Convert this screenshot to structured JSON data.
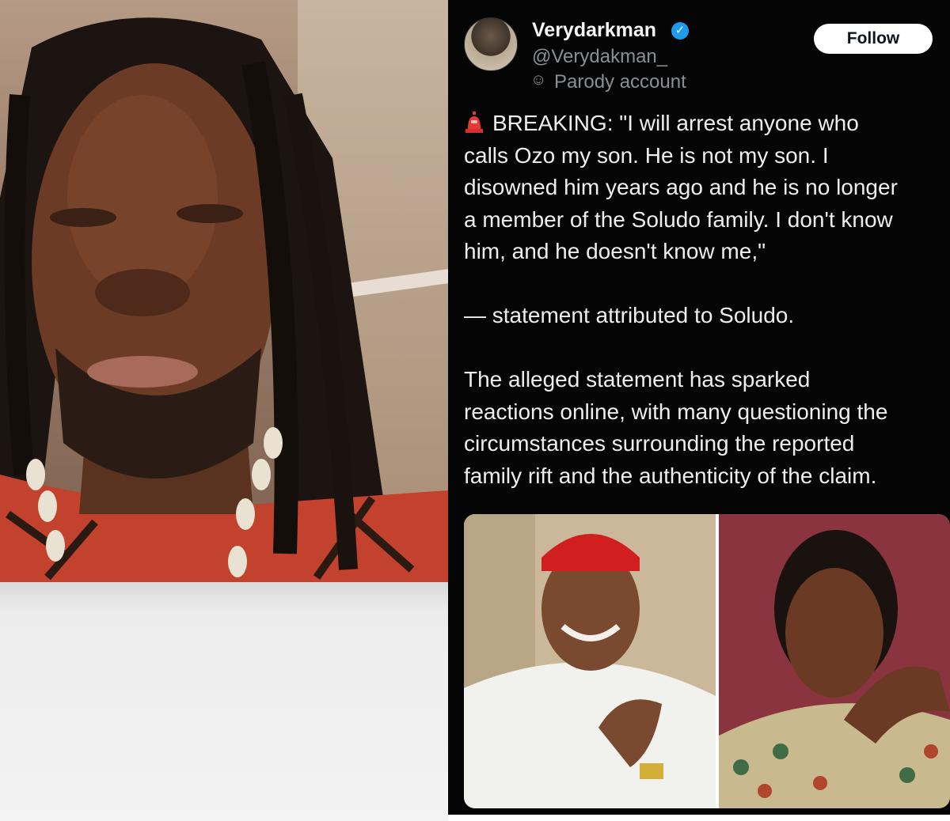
{
  "tweet": {
    "display_name": "Verydarkman",
    "verified_icon": "verified-check-icon",
    "handle": "@Verydakman_",
    "parody_icon": "drama-mask-icon",
    "parody_label": "Parody account",
    "follow_label": "Follow",
    "siren_icon": "police-siren-icon",
    "paragraph1": "BREAKING: \"I will arrest anyone who\ncalls Ozo my son. He is not my son. I\ndisowned him years ago and he is no longer\na member of the Soludo family. I don't know\nhim, and he doesn't know me,\"",
    "paragraph2": "— statement attributed to Soludo.",
    "paragraph3": "The alleged statement has sparked\nreactions online, with many questioning the\ncircumstances surrounding the reported\nfamily rift and the authenticity of the claim.",
    "accent_color": "#1d9bf0",
    "background_color": "#050505"
  }
}
